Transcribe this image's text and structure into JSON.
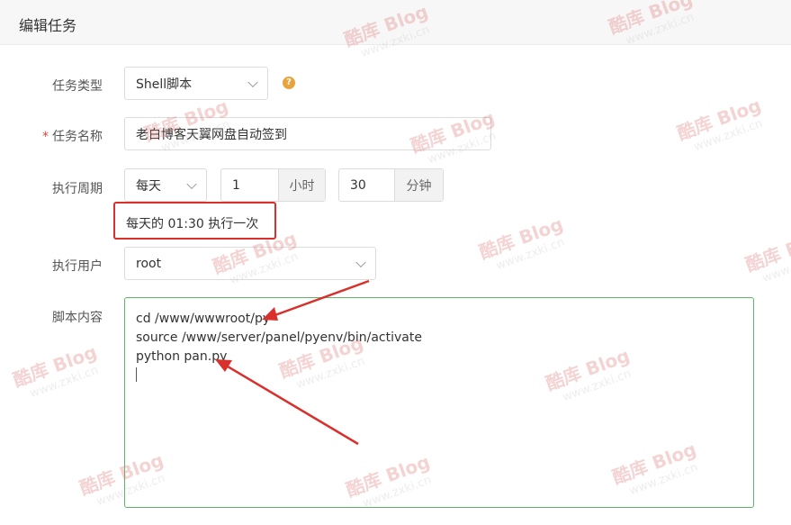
{
  "header": {
    "title": "编辑任务"
  },
  "form": {
    "task_type": {
      "label": "任务类型",
      "value": "Shell脚本",
      "help_icon": "question-circle-icon"
    },
    "task_name": {
      "required_mark": "*",
      "label": "任务名称",
      "value": "老白博客天翼网盘自动签到"
    },
    "schedule": {
      "label": "执行周期",
      "period": "每天",
      "hour_value": "1",
      "hour_unit": "小时",
      "minute_value": "30",
      "minute_unit": "分钟",
      "summary": "每天的 01:30 执行一次"
    },
    "run_user": {
      "label": "执行用户",
      "value": "root"
    },
    "script": {
      "label": "脚本内容",
      "lines": [
        "cd /www/wwwroot/py",
        "source /www/server/panel/pyenv/bin/activate",
        "python pan.py"
      ]
    }
  },
  "watermark": {
    "brand": "酷库 Blog",
    "url": "www.zxki.cn"
  },
  "colors": {
    "highlight_red": "#d9302c",
    "editor_border": "#5fb36b",
    "help_orange": "#e8a33d"
  }
}
